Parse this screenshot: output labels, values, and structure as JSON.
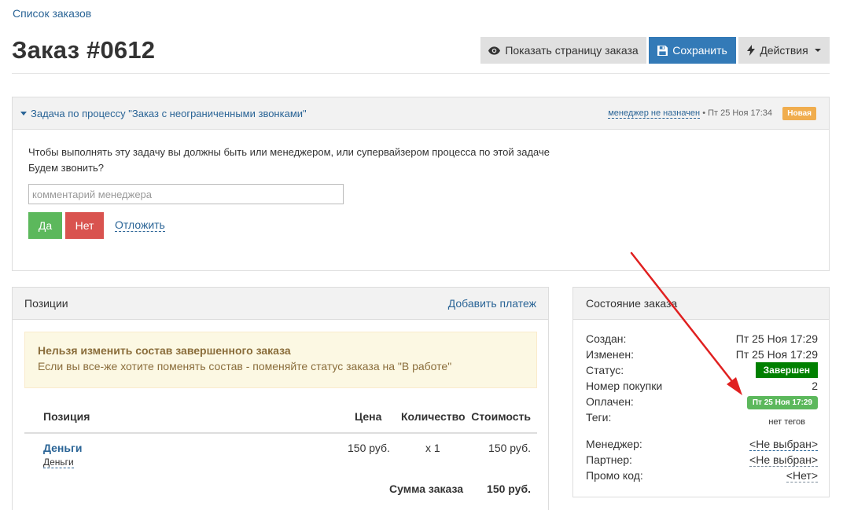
{
  "breadcrumb": "Список заказов",
  "title": "Заказ #0612",
  "toolbar": {
    "show_page_label": "Показать страницу заказа",
    "save_label": "Сохранить",
    "actions_label": "Действия"
  },
  "task": {
    "title": "Задача по процессу \"Заказ с неограниченными звонками\"",
    "manager_link": "менеджер не назначен",
    "meta_time": "• Пт 25 Ноя 17:34",
    "badge": "Новая",
    "text1": "Чтобы выполнять эту задачу вы должны быть или менеджером, или супервайзером процесса по этой задаче",
    "text2": "Будем звонить?",
    "comment_placeholder": "комментарий менеджера",
    "yes_label": "Да",
    "no_label": "Нет",
    "postpone_label": "Отложить"
  },
  "positions": {
    "title": "Позиции",
    "add_payment": "Добавить платеж",
    "alert_title": "Нельзя изменить состав завершенного заказа",
    "alert_text": "Если вы все-же хотите поменять состав - поменяйте статус заказа на \"В работе\"",
    "columns": [
      "Позиция",
      "Цена",
      "Количество",
      "Стоимость"
    ],
    "rows": [
      {
        "name": "Деньги",
        "sub": "Деньги",
        "price": "150 руб.",
        "qty": "x 1",
        "cost": "150 руб."
      }
    ],
    "sum_label": "Сумма заказа",
    "sum_value": "150 руб."
  },
  "state": {
    "title": "Состояние заказа",
    "created_label": "Создан:",
    "created_value": "Пт 25 Ноя 17:29",
    "modified_label": "Изменен:",
    "modified_value": "Пт 25 Ноя 17:29",
    "status_label": "Статус:",
    "status_value": "Завершен",
    "purchase_label": "Номер покупки",
    "purchase_value": "2",
    "paid_label": "Оплачен:",
    "paid_value": "Пт 25 Ноя 17:29",
    "tags_label": "Теги:",
    "tags_value": "нет тегов",
    "manager_label": "Менеджер:",
    "manager_value": "<Не выбран>",
    "partner_label": "Партнер:",
    "partner_value": "<Не выбран>",
    "promo_label": "Промо код:",
    "promo_value": "<Нет>"
  },
  "colors": {
    "primary": "#337ab7",
    "success": "#5cb85c",
    "danger": "#d9534f",
    "warning": "#f0ad4e",
    "status_done": "#008000",
    "annotation_arrow": "#e02020"
  },
  "icons": {
    "show_page": "eye-icon",
    "save": "floppy-disk-icon",
    "actions": "lightning-bolt-icon"
  }
}
